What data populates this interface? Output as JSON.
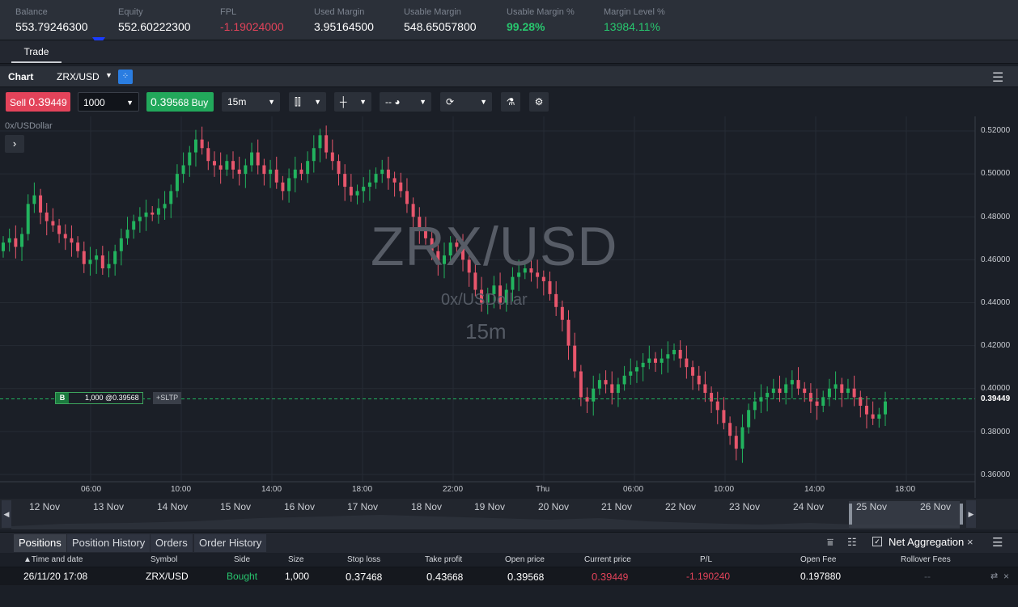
{
  "account": {
    "stats": [
      {
        "label": "Balance",
        "value": "553.79246300",
        "color": "#ffffff"
      },
      {
        "label": "Equity",
        "value": "552.60222300",
        "color": "#ffffff"
      },
      {
        "label": "FPL",
        "value": "-1.19024000",
        "color": "#e3435a"
      },
      {
        "label": "Used Margin",
        "value": "3.95164500",
        "color": "#ffffff"
      },
      {
        "label": "Usable Margin",
        "value": "548.65057800",
        "color": "#ffffff"
      },
      {
        "label": "Usable Margin %",
        "value": "99.28%",
        "color": "#28c76f"
      },
      {
        "label": "Margin Level %",
        "value": "13984.11%",
        "color": "#28c76f"
      }
    ]
  },
  "tabs": {
    "trade": "Trade"
  },
  "chart_header": {
    "title": "Chart",
    "symbol": "ZRX/USD"
  },
  "toolbar": {
    "sell_label": "Sell",
    "sell_price_big": "0.39",
    "sell_price_small": "449",
    "quantity": "1000",
    "buy_price_big": "0.39",
    "buy_price_small": "568",
    "buy_label": "Buy",
    "timeframe": "15m",
    "crosshair_value": "--"
  },
  "chart": {
    "subtitle": "0x/USDollar",
    "watermark_symbol": "ZRX/USD",
    "watermark_name": "0x/USDollar",
    "watermark_tf": "15m",
    "position_badge": "B",
    "position_text": "1,000 @0.39568",
    "sltp": "+SLTP",
    "current_price": "0.39449"
  },
  "navigator": {
    "dates": [
      "12 Nov",
      "13 Nov",
      "14 Nov",
      "15 Nov",
      "16 Nov",
      "17 Nov",
      "18 Nov",
      "19 Nov",
      "20 Nov",
      "21 Nov",
      "22 Nov",
      "23 Nov",
      "24 Nov",
      "25 Nov",
      "26 Nov"
    ]
  },
  "bottom": {
    "tabs": [
      "Positions",
      "Position History",
      "Orders",
      "Order History"
    ],
    "net_aggregation": "Net Aggregation",
    "columns": [
      "Time and date",
      "Symbol",
      "Side",
      "Size",
      "Stop loss",
      "Take profit",
      "Open price",
      "Current price",
      "P/L",
      "Open Fee",
      "Rollover Fees"
    ],
    "row": {
      "time": "26/11/20 17:08",
      "symbol": "ZRX/USD",
      "side": "Bought",
      "size": "1,000",
      "sl_big": "0.37",
      "sl_small": "468",
      "tp_big": "0.43",
      "tp_small": "668",
      "open_big": "0.39",
      "open_small": "568",
      "cur_big": "0.39",
      "cur_small": "449",
      "pl": "-1.190240",
      "open_fee": "0.197880",
      "rollover": "--"
    }
  },
  "chart_data": {
    "type": "candlestick",
    "x_ticks": [
      "06:00",
      "10:00",
      "14:00",
      "18:00",
      "22:00",
      "Thu",
      "06:00",
      "10:00",
      "14:00",
      "18:00"
    ],
    "y_ticks": [
      0.52,
      0.5,
      0.48,
      0.46,
      0.44,
      0.42,
      0.4,
      0.38,
      0.36
    ],
    "ylim": [
      0.355,
      0.525
    ],
    "close": [
      0.468,
      0.47,
      0.466,
      0.472,
      0.486,
      0.49,
      0.482,
      0.478,
      0.476,
      0.472,
      0.47,
      0.468,
      0.464,
      0.458,
      0.46,
      0.462,
      0.456,
      0.458,
      0.464,
      0.47,
      0.474,
      0.478,
      0.48,
      0.482,
      0.481,
      0.484,
      0.486,
      0.492,
      0.5,
      0.504,
      0.51,
      0.516,
      0.512,
      0.506,
      0.504,
      0.502,
      0.506,
      0.502,
      0.5,
      0.504,
      0.51,
      0.504,
      0.5,
      0.502,
      0.496,
      0.492,
      0.498,
      0.502,
      0.5,
      0.506,
      0.512,
      0.518,
      0.51,
      0.506,
      0.5,
      0.494,
      0.49,
      0.492,
      0.494,
      0.496,
      0.5,
      0.502,
      0.498,
      0.496,
      0.492,
      0.486,
      0.48,
      0.474,
      0.47,
      0.464,
      0.458,
      0.462,
      0.468,
      0.466,
      0.46,
      0.454,
      0.446,
      0.44,
      0.444,
      0.448,
      0.44,
      0.446,
      0.452,
      0.454,
      0.456,
      0.454,
      0.452,
      0.45,
      0.444,
      0.438,
      0.432,
      0.42,
      0.408,
      0.396,
      0.394,
      0.4,
      0.404,
      0.402,
      0.398,
      0.402,
      0.406,
      0.408,
      0.41,
      0.412,
      0.414,
      0.412,
      0.414,
      0.416,
      0.418,
      0.414,
      0.41,
      0.406,
      0.402,
      0.398,
      0.394,
      0.39,
      0.384,
      0.378,
      0.372,
      0.382,
      0.39,
      0.394,
      0.396,
      0.398,
      0.4,
      0.398,
      0.402,
      0.404,
      0.4,
      0.398,
      0.394,
      0.392,
      0.396,
      0.4,
      0.402,
      0.398,
      0.4,
      0.396,
      0.392,
      0.388,
      0.386,
      0.388,
      0.394
    ]
  }
}
